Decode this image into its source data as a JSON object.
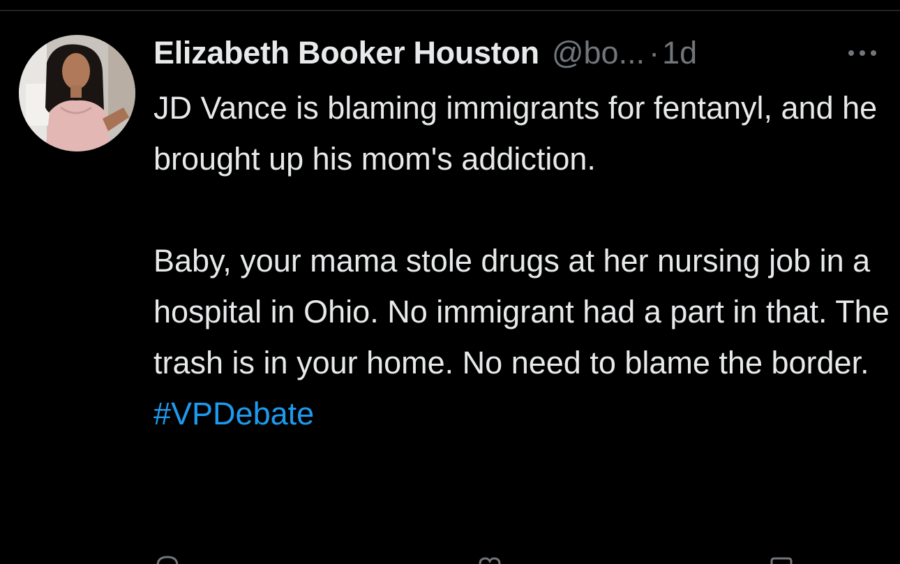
{
  "tweet": {
    "author": {
      "display_name": "Elizabeth Booker Houston",
      "handle": "@bo...",
      "avatar_icon": "profile-photo"
    },
    "separator": "·",
    "timestamp": "1d",
    "more_icon": "more-horizontal-icon",
    "body": {
      "paragraph_1": "JD Vance is blaming immigrants for fentanyl, and he brought up his mom's addiction.",
      "paragraph_2_text": "Baby, your mama stole drugs at her nursing job in a hospital in Ohio. No immigrant had a part in that. The trash is in your home. No need to blame the border.",
      "hashtag": "#VPDebate"
    },
    "actions": [
      "reply-icon",
      "retweet-icon",
      "like-icon",
      "views-icon",
      "bookmark-icon"
    ]
  },
  "colors": {
    "background": "#000000",
    "primary_text": "#e7e9ea",
    "secondary_text": "#71767b",
    "link": "#1d9bf0",
    "divider": "#1f2326"
  }
}
